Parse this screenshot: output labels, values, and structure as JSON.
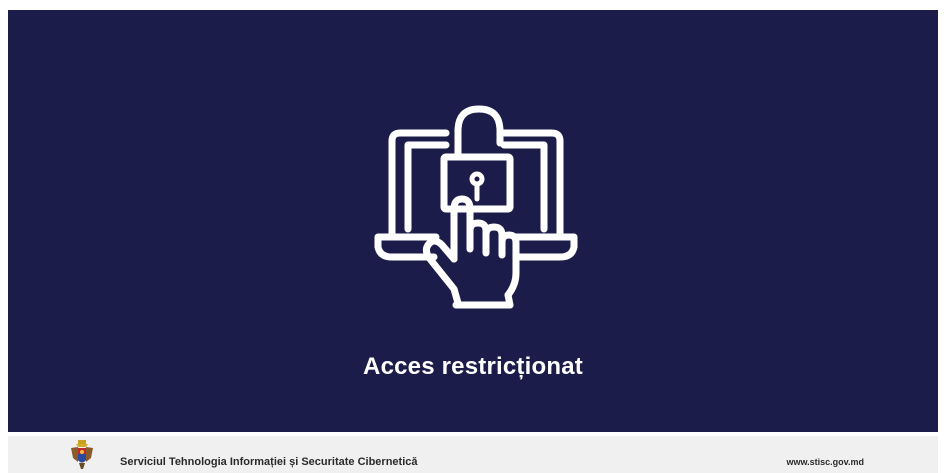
{
  "main": {
    "icon": "locked-laptop-hand-icon",
    "title": "Acces restricționat",
    "background_color": "#1c1c4a"
  },
  "footer": {
    "emblem": "moldova-coat-of-arms-icon",
    "organization": "Serviciul Tehnologia Informației și Securitate Cibernetică",
    "website": "www.stisc.gov.md"
  }
}
